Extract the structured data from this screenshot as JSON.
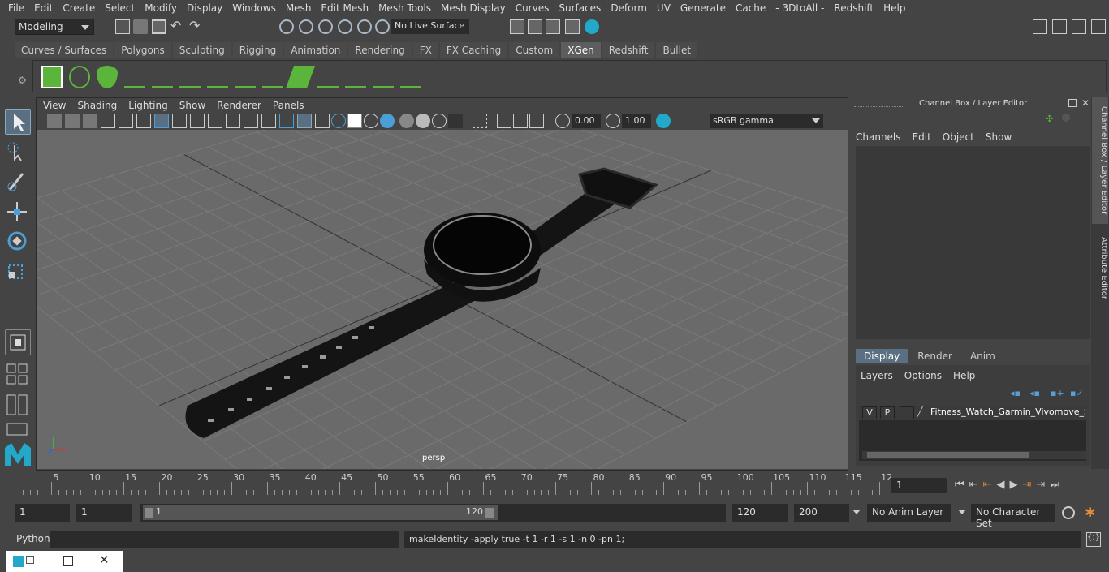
{
  "menu": [
    "File",
    "Edit",
    "Create",
    "Select",
    "Modify",
    "Display",
    "Windows",
    "Mesh",
    "Edit Mesh",
    "Mesh Tools",
    "Mesh Display",
    "Curves",
    "Surfaces",
    "Deform",
    "UV",
    "Generate",
    "Cache",
    "- 3DtoAll -",
    "Redshift",
    "Help"
  ],
  "status": {
    "mode": "Modeling",
    "live_surface": "No Live Surface"
  },
  "shelf_tabs": [
    {
      "label": "Curves / Surfaces"
    },
    {
      "label": "Polygons"
    },
    {
      "label": "Sculpting"
    },
    {
      "label": "Rigging"
    },
    {
      "label": "Animation"
    },
    {
      "label": "Rendering"
    },
    {
      "label": "FX"
    },
    {
      "label": "FX Caching"
    },
    {
      "label": "Custom"
    },
    {
      "label": "XGen",
      "active": true
    },
    {
      "label": "Redshift"
    },
    {
      "label": "Bullet"
    }
  ],
  "viewport": {
    "menu": [
      "View",
      "Shading",
      "Lighting",
      "Show",
      "Renderer",
      "Panels"
    ],
    "exposure": "0.00",
    "gamma": "1.00",
    "color_space": "sRGB gamma",
    "camera_label": "persp"
  },
  "right_panel": {
    "title": "Channel Box / Layer Editor",
    "channel_menu": [
      "Channels",
      "Edit",
      "Object",
      "Show"
    ],
    "layer_tabs": [
      "Display",
      "Render",
      "Anim"
    ],
    "layer_menu": [
      "Layers",
      "Options",
      "Help"
    ],
    "layer": {
      "v": "V",
      "p": "P",
      "name": "Fitness_Watch_Garmin_Vivomove_Sp"
    }
  },
  "side_tabs": [
    "Channel Box / Layer Editor",
    "Attribute Editor"
  ],
  "timeline": {
    "ticks": [
      "5",
      "10",
      "15",
      "20",
      "25",
      "30",
      "35",
      "40",
      "45",
      "50",
      "55",
      "60",
      "65",
      "70",
      "75",
      "80",
      "85",
      "90",
      "95",
      "100",
      "105",
      "110",
      "115",
      "12"
    ],
    "start_label": "1",
    "current_frame": "1"
  },
  "range": {
    "start": "1",
    "playback_start": "1",
    "slider_start": "1",
    "slider_end": "120",
    "playback_end": "120",
    "end": "200",
    "anim_layer": "No Anim Layer",
    "char_set": "No Character Set"
  },
  "command": {
    "lang": "Python",
    "output": "makeIdentity -apply true -t 1 -r 1 -s 1 -n 0 -pn 1;"
  },
  "colors": {
    "accent": "#5285a6",
    "icon_green": "#5bb53a",
    "icon_teal": "#22a8c8"
  }
}
